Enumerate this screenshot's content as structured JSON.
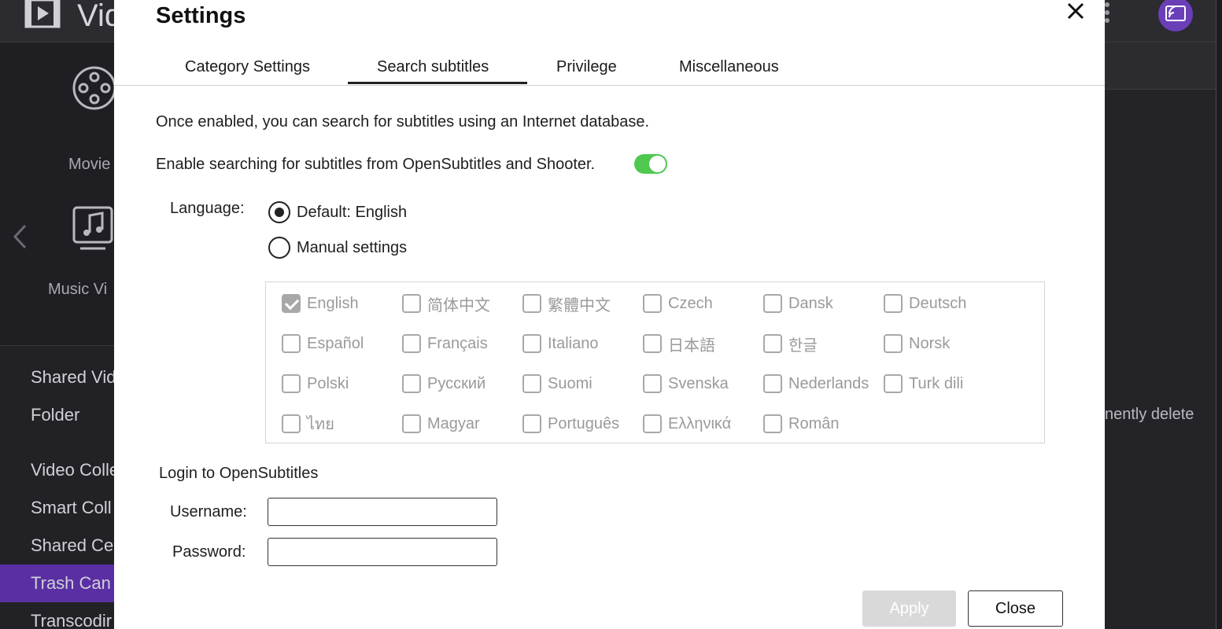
{
  "app": {
    "title": "Vid",
    "sidebar": {
      "movies_label": "Movie",
      "music_label": "Music Vi",
      "items": [
        "Shared Vid",
        "Folder",
        "Video Colle",
        "Smart Coll",
        "Shared Ce",
        "Trash Can",
        "Transcodir"
      ],
      "active_item": "Trash Can"
    },
    "right_text": "nently delete"
  },
  "dialog": {
    "title": "Settings",
    "tabs": [
      {
        "label": "Category Settings"
      },
      {
        "label": "Search subtitles",
        "active": true
      },
      {
        "label": "Privilege"
      },
      {
        "label": "Miscellaneous"
      }
    ],
    "description": "Once enabled, you can search for subtitles using an Internet database.",
    "enable_label": "Enable searching for subtitles from OpenSubtitles and Shooter.",
    "enable_on": true,
    "language_label": "Language:",
    "radio_default": "Default: English",
    "radio_manual": "Manual settings",
    "radio_selected": "default",
    "languages": [
      {
        "label": "English",
        "checked": true
      },
      {
        "label": "简体中文",
        "checked": false
      },
      {
        "label": "繁體中文",
        "checked": false
      },
      {
        "label": "Czech",
        "checked": false
      },
      {
        "label": "Dansk",
        "checked": false
      },
      {
        "label": "Deutsch",
        "checked": false
      },
      {
        "label": "Español",
        "checked": false
      },
      {
        "label": "Français",
        "checked": false
      },
      {
        "label": "Italiano",
        "checked": false
      },
      {
        "label": "日本語",
        "checked": false
      },
      {
        "label": "한글",
        "checked": false
      },
      {
        "label": "Norsk",
        "checked": false
      },
      {
        "label": "Polski",
        "checked": false
      },
      {
        "label": "Русский",
        "checked": false
      },
      {
        "label": "Suomi",
        "checked": false
      },
      {
        "label": "Svenska",
        "checked": false
      },
      {
        "label": "Nederlands",
        "checked": false
      },
      {
        "label": "Turk dili",
        "checked": false
      },
      {
        "label": "ไทย",
        "checked": false
      },
      {
        "label": "Magyar",
        "checked": false
      },
      {
        "label": "Português",
        "checked": false
      },
      {
        "label": "Ελληνικά",
        "checked": false
      },
      {
        "label": "Român",
        "checked": false
      }
    ],
    "login_title": "Login to OpenSubtitles",
    "username_label": "Username:",
    "username_value": "",
    "password_label": "Password:",
    "password_value": "",
    "apply_label": "Apply",
    "close_label": "Close"
  },
  "colors": {
    "accent_purple": "#5a2fa3",
    "toggle_on": "#4fc84f"
  },
  "icons": {
    "app_logo": "film-icon",
    "more": "vertical-dots-icon",
    "cast": "cast-icon",
    "close": "close-icon"
  }
}
